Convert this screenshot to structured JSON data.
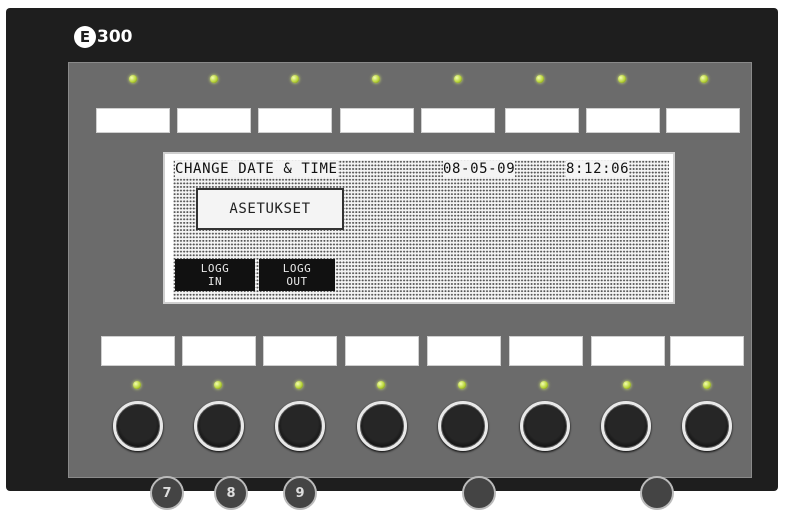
{
  "logo": {
    "badge": "E",
    "model": "300"
  },
  "lcd": {
    "title": "CHANGE DATE & TIME",
    "date": "08-05-09",
    "time": "8:12:06",
    "menu_button": "ASETUKSET",
    "login": {
      "line1": "LOGG",
      "line2": "IN"
    },
    "logout": {
      "line1": "LOGG",
      "line2": "OUT"
    }
  },
  "bottom_buttons": [
    "7",
    "8",
    "9"
  ],
  "colors": {
    "bezel": "#1e1e1e",
    "panel": "#6b6b6b",
    "led": "#b8d43a",
    "lcd_background": "#f4f4f4",
    "lcd_dots": "#555555"
  },
  "icons": {
    "leds": "led-indicator",
    "knobs": "rotary-encoder"
  }
}
